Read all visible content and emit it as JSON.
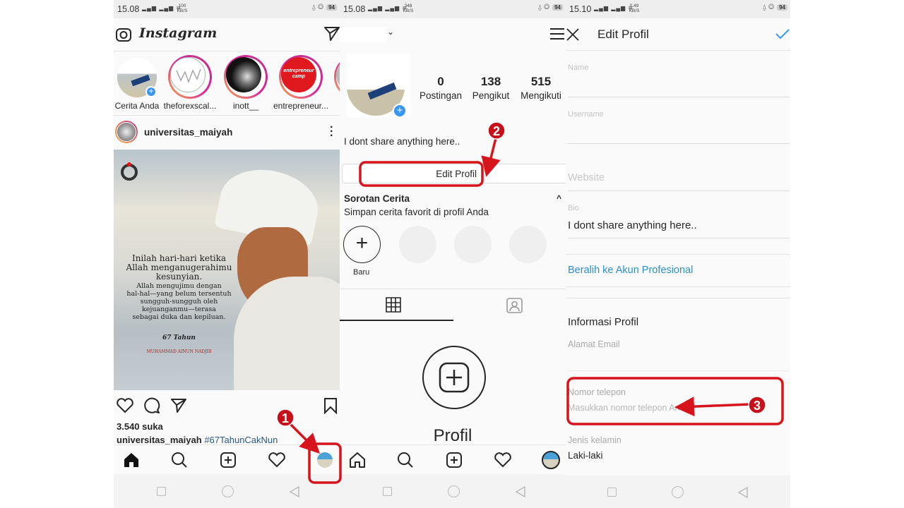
{
  "feed": {
    "status": {
      "time": "15.08",
      "speed": "100 KB/S",
      "battery": "94"
    },
    "logo": "Instagram",
    "stories": [
      {
        "label": "Cerita Anda"
      },
      {
        "label": "theforexscal..."
      },
      {
        "label": "inott__"
      },
      {
        "label": "entrepreneur..."
      }
    ],
    "story_badge_text": "entrepreneur camp",
    "post": {
      "username": "universitas_maiyah",
      "quote_main": [
        "Inilah hari-hari ketika",
        "Allah menganugerahimu",
        "kesunyian."
      ],
      "quote_sub": [
        "Allah mengujimu dengan",
        "hal-hal—yang belum tersentuh",
        "sungguh-sungguh oleh",
        "kejuanganmu—terasa",
        "sebagai duka dan kepiluan."
      ],
      "logo_mark": "67 Tahun",
      "author": "MUHAMMAD AINUN NADJIB",
      "likes": "3.540 suka",
      "caption_user": "universitas_maiyah",
      "caption_tag": "#67TahunCakNun"
    }
  },
  "profile": {
    "status": {
      "time": "15.08",
      "speed": "348 KB/S",
      "battery": "94"
    },
    "stats": [
      {
        "value": "0",
        "label": "Postingan"
      },
      {
        "value": "138",
        "label": "Pengikut"
      },
      {
        "value": "515",
        "label": "Mengikuti"
      }
    ],
    "bio": "I dont share anything here..",
    "edit_button": "Edit Profil",
    "highlights": {
      "title": "Sorotan Cerita",
      "subtitle": "Simpan cerita favorit di profil Anda",
      "new_label": "Baru"
    },
    "empty_title": "Profil"
  },
  "edit": {
    "status": {
      "time": "15.10",
      "speed": "0.49 KB/S",
      "battery": "94"
    },
    "title": "Edit Profil",
    "fields": {
      "name_label": "Name",
      "username_label": "Username",
      "website_placeholder": "Website",
      "bio_label": "Bio",
      "bio_value": "I dont share anything here..",
      "professional_link": "Beralih ke Akun Profesional",
      "section_title": "Informasi Profil",
      "email_label": "Alamat Email",
      "phone_label": "Nomor telepon",
      "phone_placeholder": "Masukkan nomor telepon Anda",
      "gender_label": "Jenis kelamin",
      "gender_value": "Laki-laki"
    }
  },
  "annotations": {
    "steps": [
      "1",
      "2",
      "3"
    ],
    "color": "#d7141b"
  },
  "colors": {
    "link": "#2b8fd0",
    "accent_blue": "#3897f0"
  }
}
